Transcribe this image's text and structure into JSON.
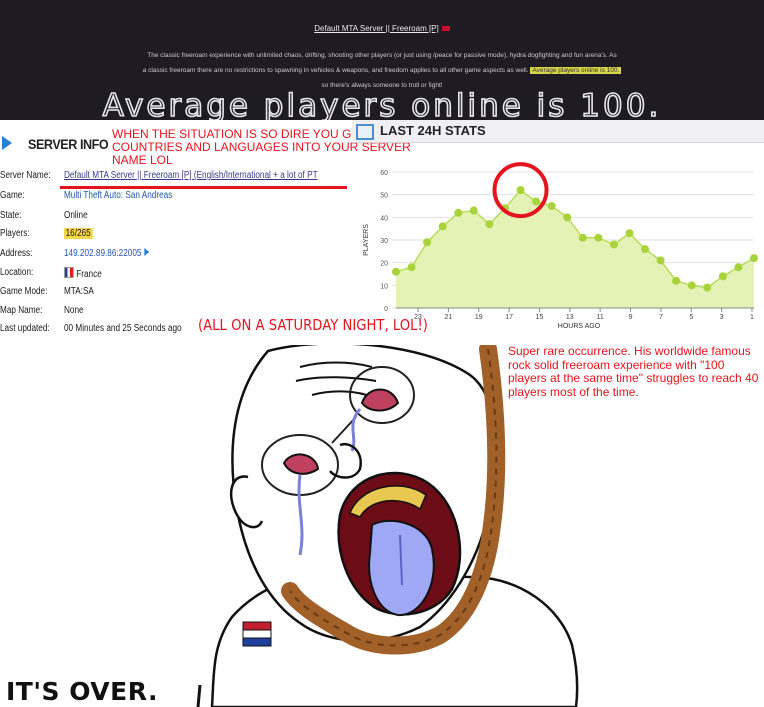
{
  "top": {
    "title": "Default MTA Server || Freeroam [P]",
    "description_line1": "The classic freeroam experience with unlimited chaos, drifting, shooting other players (or just using /peace for passive mode), hydra dogfighting and fun arena's. As",
    "description_line2": "a classic freeroam there are no restrictions to spawning in vehicles & weapons, and freedom applies to all other game aspects as well.",
    "description_highlight": "Average players online is 100.",
    "description_line3": "so there's always someone to troll or fight!",
    "big_text": "Average players online is 100."
  },
  "server_info": {
    "title": "SERVER INFO",
    "red_note": "WHEN THE SITUATION IS SO DIRE YOU GOTTA ADD COUNTRIES AND LANGUAGES INTO YOUR SERVER NAME LOL",
    "rows": [
      {
        "key": "Server Name:",
        "value": "Default MTA Server || Freeroam [P] (English/International + a lot of PT"
      },
      {
        "key": "Game:",
        "value": "Multi Theft Auto: San Andreas"
      },
      {
        "key": "State:",
        "value": "Online"
      },
      {
        "key": "Players:",
        "value": "16/265"
      },
      {
        "key": "Address:",
        "value": "149.202.89.86:22005"
      },
      {
        "key": "Location:",
        "value": "France"
      },
      {
        "key": "Game Mode:",
        "value": "MTA:SA"
      },
      {
        "key": "Map Name:",
        "value": "None"
      },
      {
        "key": "Last updated:",
        "value": "00 Minutes and 25 Seconds ago"
      }
    ],
    "saturday_note": "(ALL ON A SATURDAY NIGHT, LOL!)"
  },
  "stats": {
    "title": "LAST 24H STATS"
  },
  "chart_data": {
    "type": "area",
    "title": "LAST 24H STATS",
    "xlabel": "HOURS AGO",
    "ylabel": "PLAYERS",
    "x_tick_labels": [
      "23",
      "21",
      "19",
      "17",
      "15",
      "13",
      "11",
      "9",
      "7",
      "5",
      "3",
      "1"
    ],
    "ylim": [
      0,
      60
    ],
    "y_ticks": [
      0,
      10,
      20,
      30,
      40,
      50,
      60
    ],
    "values": [
      16,
      18,
      29,
      36,
      42,
      43,
      37,
      44,
      52,
      47,
      45,
      40,
      31,
      31,
      28,
      33,
      26,
      21,
      12,
      10,
      9,
      14,
      18,
      22
    ],
    "colors": {
      "fill": "#e4f2b6",
      "line": "#b8dc58",
      "point": "#a8d33a"
    },
    "annotation": "red circle around peak"
  },
  "comic": {
    "note": "Super rare occurrence. His worldwide famous rock solid freeroam experience with \"100 players at the same time\" struggles to reach 40 players most of the time.",
    "caption": "IT'S OVER."
  },
  "colors": {
    "red": "#e4151f",
    "banner": "#1e1c22",
    "highlight": "#d8d44a"
  }
}
